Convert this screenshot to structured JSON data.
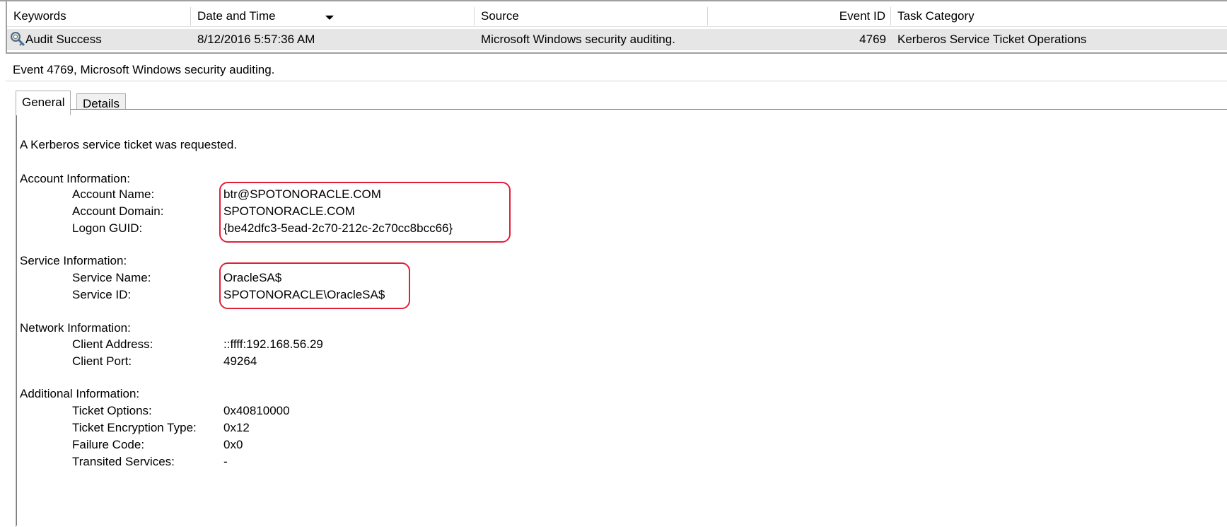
{
  "event_list": {
    "columns": [
      "Keywords",
      "Date and Time",
      "Source",
      "Event ID",
      "Task Category"
    ],
    "row": {
      "keywords": "Audit Success",
      "date_time": "8/12/2016 5:57:36 AM",
      "source": "Microsoft Windows security auditing.",
      "event_id": "4769",
      "task_category": "Kerberos Service Ticket Operations",
      "icon": "audit-success-key-icon"
    }
  },
  "detail": {
    "title": "Event 4769, Microsoft Windows security auditing.",
    "tabs": [
      "General",
      "Details"
    ],
    "selected_tab": "General",
    "message": "A Kerberos service ticket was requested.",
    "sections": {
      "account": {
        "heading": "Account Information:",
        "fields": [
          {
            "label": "Account Name:",
            "value": "btr@SPOTONORACLE.COM"
          },
          {
            "label": "Account Domain:",
            "value": "SPOTONORACLE.COM"
          },
          {
            "label": "Logon GUID:",
            "value": "{be42dfc3-5ead-2c70-212c-2c70cc8bcc66}"
          }
        ]
      },
      "service": {
        "heading": "Service Information:",
        "fields": [
          {
            "label": "Service Name:",
            "value": "OracleSA$"
          },
          {
            "label": "Service ID:",
            "value": "SPOTONORACLE\\OracleSA$"
          }
        ]
      },
      "network": {
        "heading": "Network Information:",
        "fields": [
          {
            "label": "Client Address:",
            "value": "::ffff:192.168.56.29"
          },
          {
            "label": "Client Port:",
            "value": "49264"
          }
        ]
      },
      "additional": {
        "heading": "Additional Information:",
        "fields": [
          {
            "label": "Ticket Options:",
            "value": "0x40810000"
          },
          {
            "label": "Ticket Encryption Type:",
            "value": "0x12"
          },
          {
            "label": "Failure Code:",
            "value": "0x0"
          },
          {
            "label": "Transited Services:",
            "value": "-"
          }
        ]
      }
    }
  },
  "colors": {
    "highlight": "#e0203a",
    "selected_row": "#e6e6e6"
  }
}
